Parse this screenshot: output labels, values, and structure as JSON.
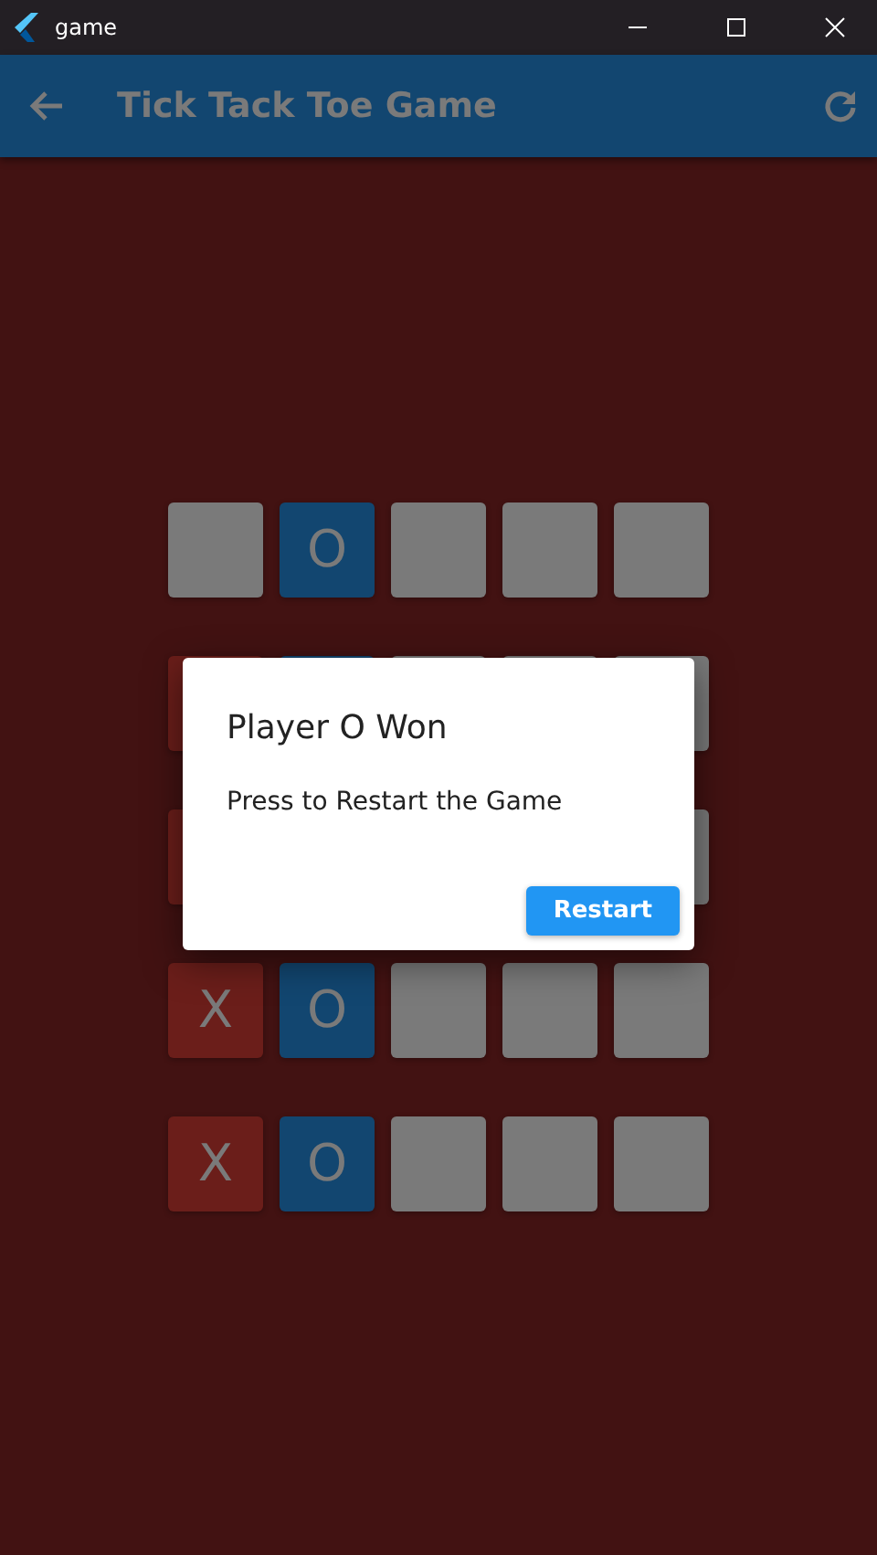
{
  "window": {
    "title": "game"
  },
  "app_bar": {
    "title": "Tick Tack Toe Game"
  },
  "board": {
    "rows": [
      {
        "cells": [
          {
            "kind": "empty"
          },
          {
            "kind": "o",
            "label": "O"
          },
          {
            "kind": "empty"
          },
          {
            "kind": "empty"
          },
          {
            "kind": "empty"
          }
        ]
      },
      {
        "cells": [
          {
            "kind": "x"
          },
          {
            "kind": "o"
          },
          {
            "kind": "empty"
          },
          {
            "kind": "empty"
          },
          {
            "kind": "empty"
          }
        ]
      },
      {
        "cells": [
          {
            "kind": "x"
          },
          {
            "kind": "hidden"
          },
          {
            "kind": "hidden"
          },
          {
            "kind": "hidden"
          },
          {
            "kind": "empty"
          }
        ]
      },
      {
        "cells": [
          {
            "kind": "x",
            "label": "X"
          },
          {
            "kind": "o",
            "label": "O"
          },
          {
            "kind": "empty"
          },
          {
            "kind": "empty"
          },
          {
            "kind": "empty"
          }
        ]
      },
      {
        "cells": [
          {
            "kind": "x",
            "label": "X"
          },
          {
            "kind": "o",
            "label": "O"
          },
          {
            "kind": "empty"
          },
          {
            "kind": "empty"
          },
          {
            "kind": "empty"
          }
        ]
      }
    ]
  },
  "dialog": {
    "title": "Player O Won",
    "message": "Press to Restart the Game",
    "button": "Restart"
  }
}
